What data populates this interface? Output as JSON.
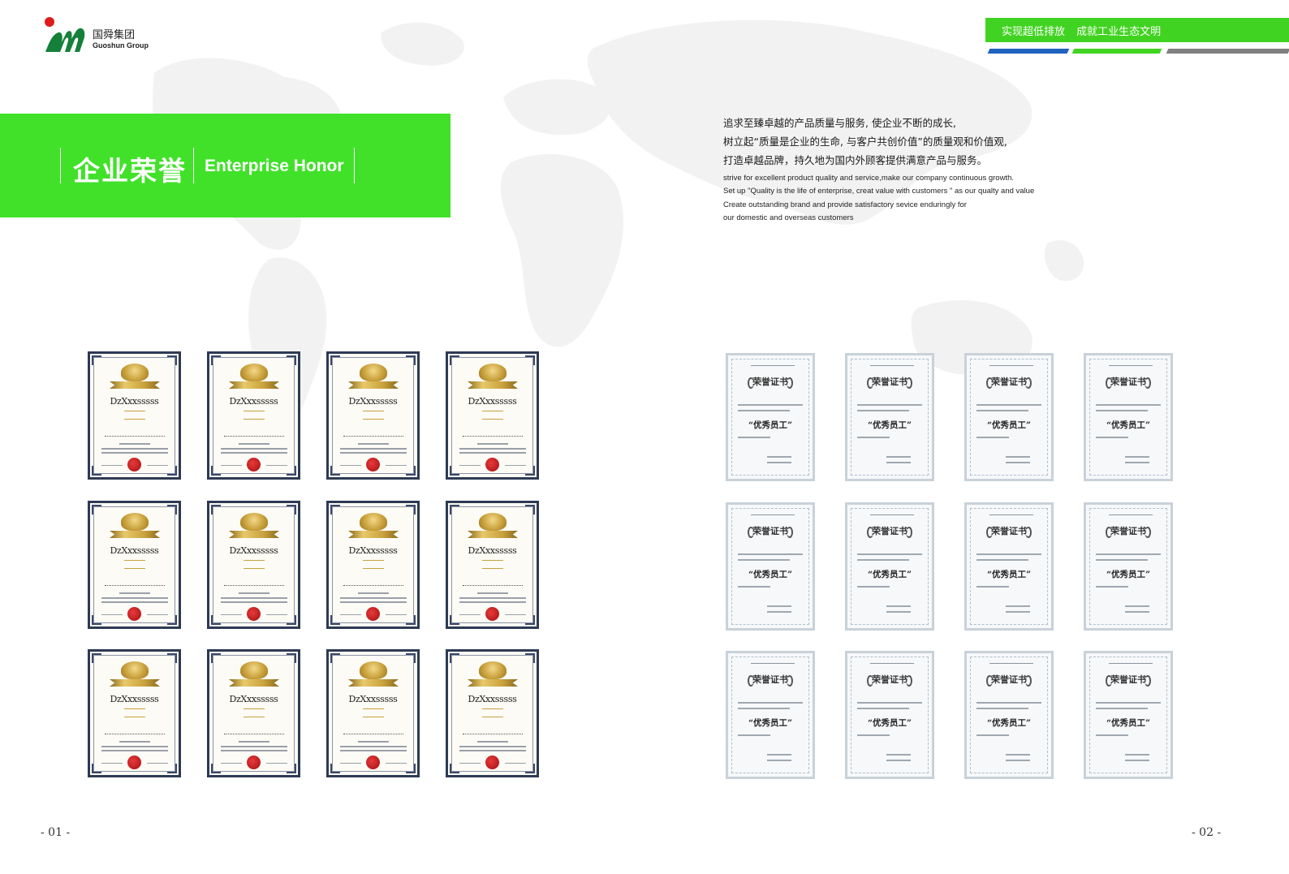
{
  "brand": {
    "name_cn": "国舜集团",
    "name_en": "Guoshun Group"
  },
  "slogan": "实现超低排放 成就工业生态文明",
  "banner": {
    "title_cn": "企业荣誉",
    "title_en": "Enterprise Honor"
  },
  "intro": {
    "cn_lines": [
      "追求至臻卓越的产品质量与服务, 使企业不断的成长,",
      "树立起“质量是企业的生命, 与客户共创价值”的质量观和价值观,",
      "打造卓越品牌，持久地为国内外顾客提供满意产品与服务。"
    ],
    "en_lines": [
      " strive for excellent product quality and service,make our company continuous growth.",
      "Set up \"Quality is the life of enterprise, creat value with customers \" as our qualty and value",
      "Create outstanding brand and provide satisfactory sevice enduringly for",
      "our domestic and overseas customers"
    ]
  },
  "certificates_left": {
    "title": "DzXxxsssss",
    "count": 12
  },
  "certificates_right": {
    "title": "荣誉证书",
    "award": "“优秀员工”",
    "count": 12
  },
  "pages": {
    "left": "- 01 -",
    "right": "- 02 -"
  },
  "colors": {
    "accent_green": "#41e12a",
    "slogan_green": "#41d321",
    "stripe_blue": "#1f62c0",
    "stripe_gray": "#808080",
    "cert_frame_navy": "#2d3a54"
  }
}
